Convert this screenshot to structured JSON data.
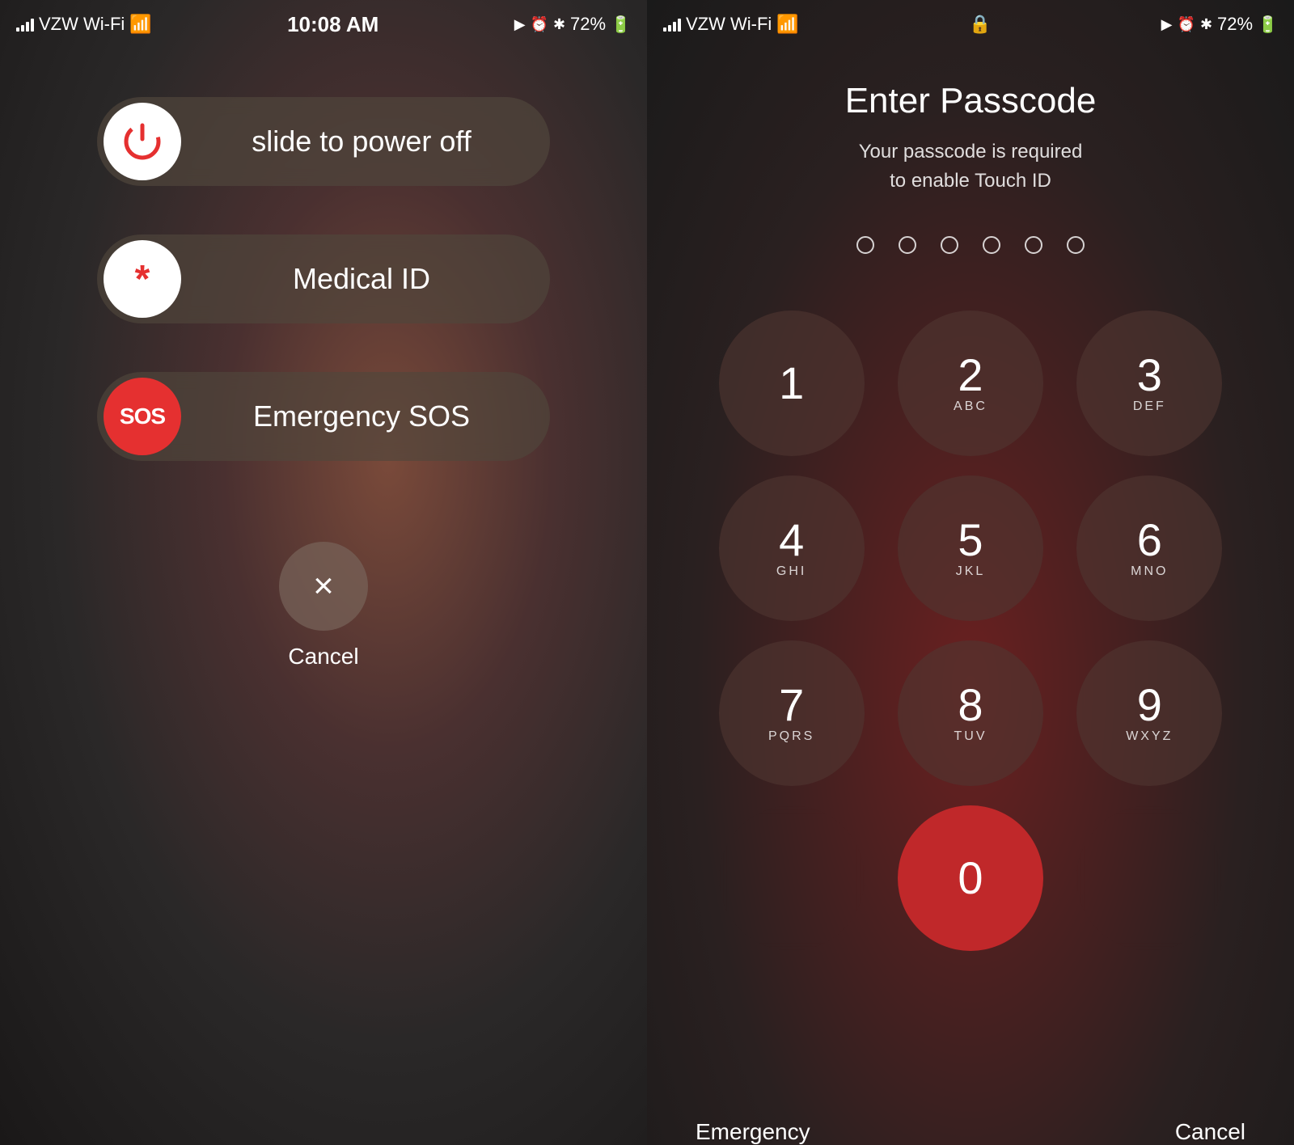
{
  "left": {
    "statusBar": {
      "signal": "VZW Wi-Fi",
      "time": "10:08 AM",
      "battery": "72%"
    },
    "slideToPowerOff": {
      "label": "slide to power off"
    },
    "medicalId": {
      "label": "Medical ID",
      "icon": "*"
    },
    "emergencySos": {
      "label": "Emergency SOS",
      "icon": "SOS"
    },
    "cancel": {
      "label": "Cancel",
      "icon": "×"
    }
  },
  "right": {
    "statusBar": {
      "signal": "VZW Wi-Fi",
      "battery": "72%"
    },
    "title": "Enter Passcode",
    "subtitle": "Your passcode is required\nto enable Touch ID",
    "keys": [
      {
        "number": "1",
        "letters": ""
      },
      {
        "number": "2",
        "letters": "ABC"
      },
      {
        "number": "3",
        "letters": "DEF"
      },
      {
        "number": "4",
        "letters": "GHI"
      },
      {
        "number": "5",
        "letters": "JKL"
      },
      {
        "number": "6",
        "letters": "MNO"
      },
      {
        "number": "7",
        "letters": "PQRS"
      },
      {
        "number": "8",
        "letters": "TUV"
      },
      {
        "number": "9",
        "letters": "WXYZ"
      },
      {
        "number": "",
        "letters": "",
        "type": "empty"
      },
      {
        "number": "0",
        "letters": "",
        "type": "zero"
      },
      {
        "number": "",
        "letters": "",
        "type": "empty"
      }
    ],
    "emergencyBtn": "Emergency",
    "cancelBtn": "Cancel"
  }
}
